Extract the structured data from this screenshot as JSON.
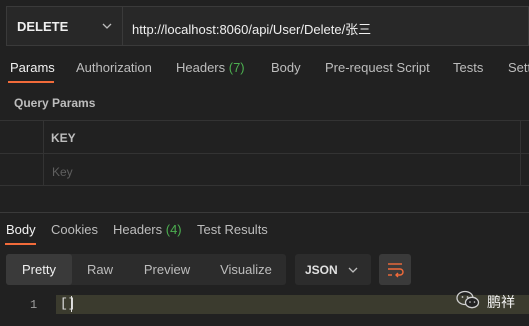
{
  "request": {
    "method": "DELETE",
    "url": "http://localhost:8060/api/User/Delete/张三"
  },
  "request_tabs": [
    {
      "label": "Params"
    },
    {
      "label": "Authorization"
    },
    {
      "label": "Headers ",
      "count": "(7)"
    },
    {
      "label": "Body"
    },
    {
      "label": "Pre-request Script"
    },
    {
      "label": "Tests"
    },
    {
      "label": "Sett"
    }
  ],
  "query_params": {
    "title": "Query Params",
    "key_header": "KEY",
    "key_placeholder": "Key"
  },
  "response_tabs": [
    {
      "label": "Body"
    },
    {
      "label": "Cookies"
    },
    {
      "label": "Headers ",
      "count": "(4)"
    },
    {
      "label": "Test Results"
    }
  ],
  "response_views": [
    "Pretty",
    "Raw",
    "Preview",
    "Visualize"
  ],
  "format": "JSON",
  "editor": {
    "line_number": "1",
    "content": "[]"
  },
  "watermark": {
    "text": "鹏祥",
    "icon": "wechat-icon"
  },
  "colors": {
    "accent": "#f26b3a",
    "count": "#4caf50",
    "background": "#212121"
  }
}
